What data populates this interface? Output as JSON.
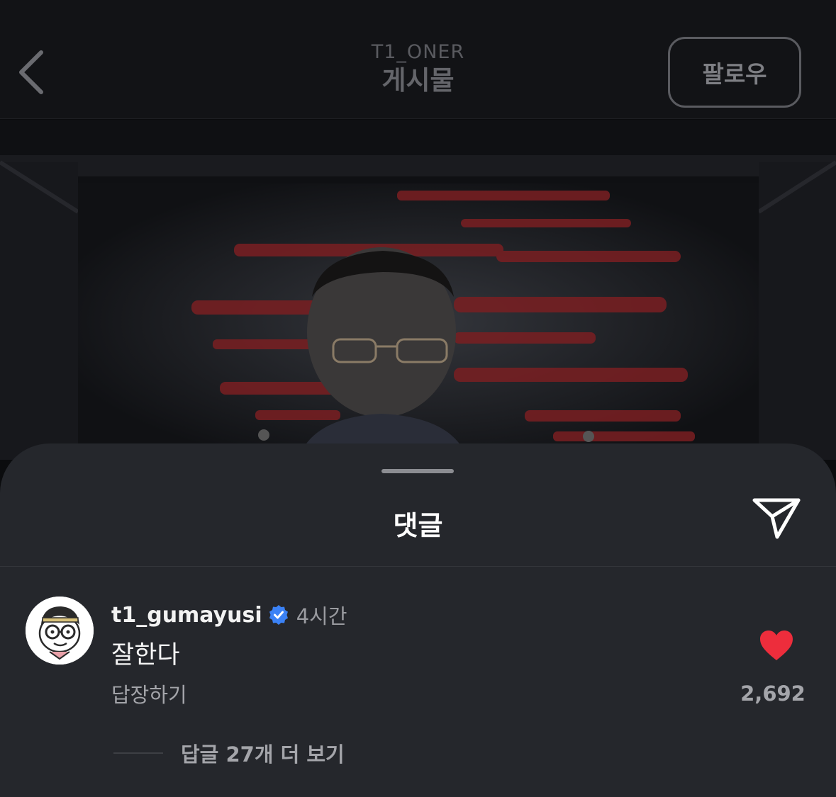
{
  "header": {
    "username": "T1_ONER",
    "title": "게시물",
    "follow_label": "팔로우"
  },
  "post": {
    "image_icon": "photo-person-on-stage"
  },
  "comments_sheet": {
    "title": "댓글",
    "share_icon": "send-paper-plane-icon",
    "comment": {
      "username": "t1_gumayusi",
      "verified": true,
      "timestamp": "4시간",
      "text": "잘한다",
      "reply_label": "답장하기",
      "liked": true,
      "like_count": "2,692",
      "view_replies_label": "답글 27개 더 보기"
    }
  },
  "colors": {
    "like_red": "#ed2d3c",
    "verified_blue": "#3b82f6",
    "sheet_bg": "#25272c",
    "header_bg": "#121316"
  }
}
